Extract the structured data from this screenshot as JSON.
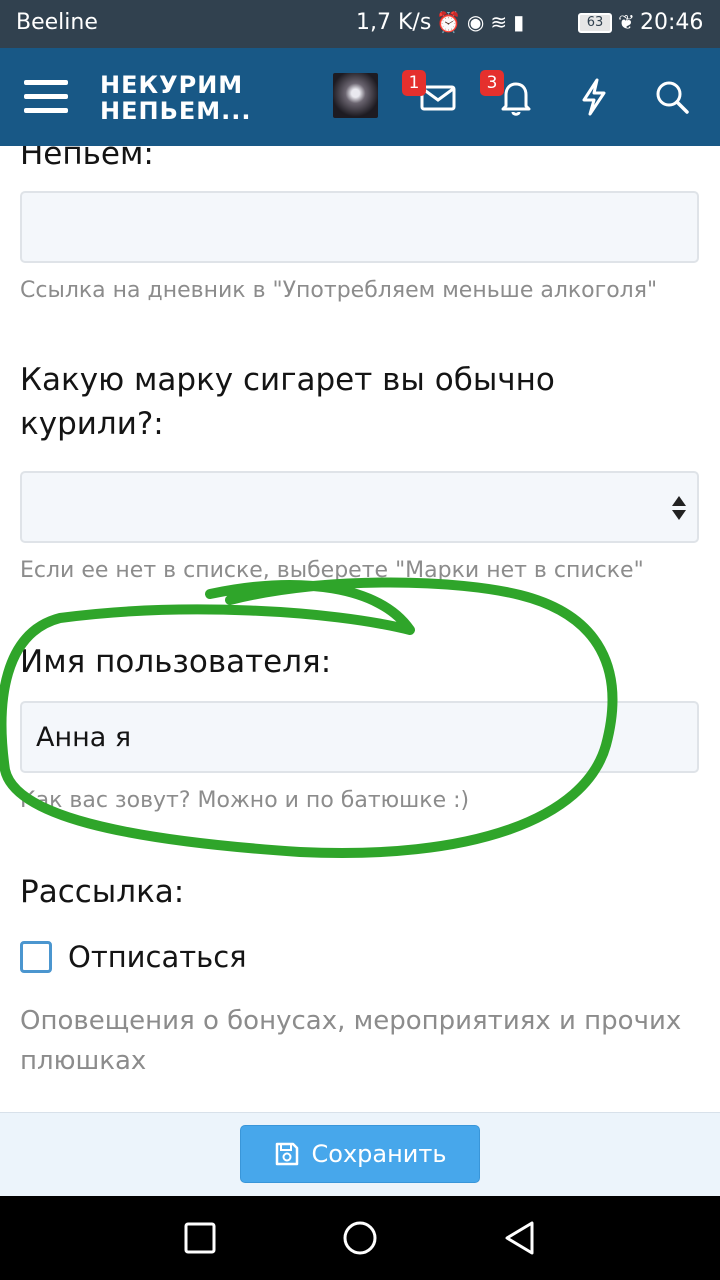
{
  "status_bar": {
    "carrier": "Beeline",
    "speed": "1,7 K/s",
    "battery": "63",
    "time": "20:46",
    "icons": [
      "alarm-icon",
      "eye-icon",
      "wifi-icon",
      "signal-icon",
      "battery-icon",
      "leaf-icon"
    ]
  },
  "header": {
    "logo_line1": "НЕКУРИМ",
    "logo_line2": "НЕПЬЕМ...",
    "messages_badge": "1",
    "alerts_badge": "3",
    "background": "#185886"
  },
  "form": {
    "partial_label": "Непьем:",
    "diary_field_value": "",
    "diary_hint": "Ссылка на дневник в \"Употребляем меньше алкоголя\"",
    "brand_label_line1": "Какую марку сигарет вы обычно",
    "brand_label_line2": "курили?:",
    "brand_select_value": "",
    "brand_hint": "Если ее нет в списке, выберете \"Марки нет в списке\"",
    "username_label": "Имя пользователя:",
    "username_value": "Анна я",
    "username_hint": "Как вас зовут? Можно и по батюшке :)",
    "mailing_label": "Рассылка:",
    "unsubscribe_label": "Отписаться",
    "unsubscribe_checked": false,
    "mailing_hint_line1": "Оповещения о бонусах, мероприятиях и прочих",
    "mailing_hint_line2": "плюшках"
  },
  "save_button": {
    "label": "Сохранить",
    "color": "#47a7eb"
  },
  "annotation": {
    "color": "#2fa52a"
  }
}
